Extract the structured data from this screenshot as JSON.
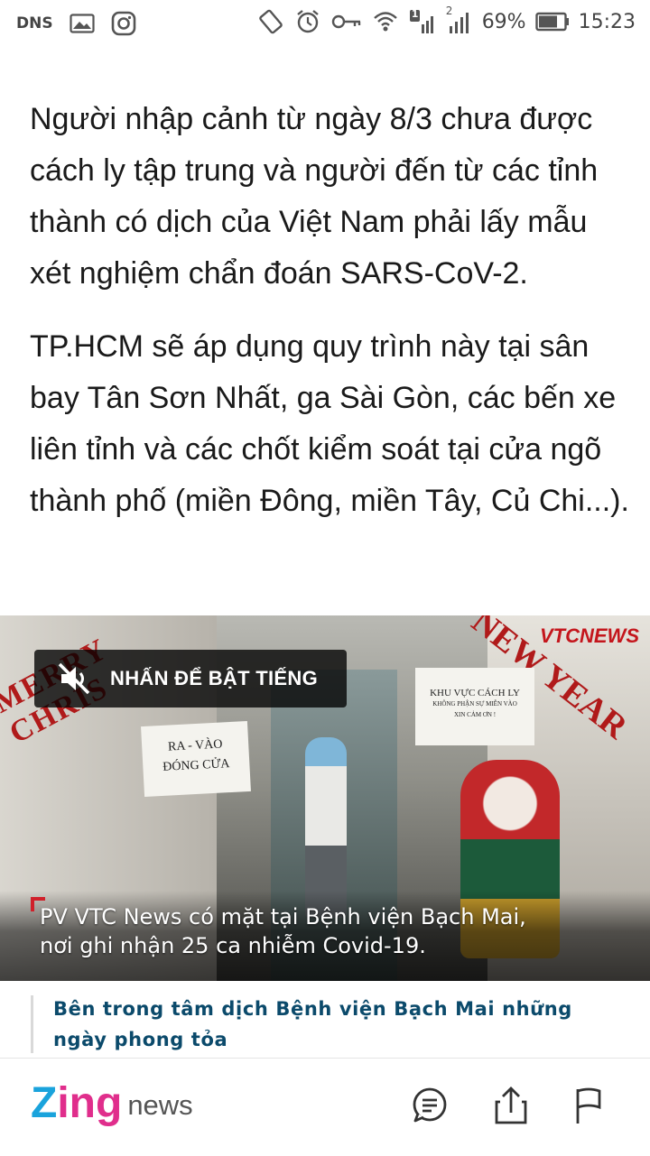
{
  "status_bar": {
    "carrier": "DNS",
    "sim1_badge": "1",
    "sim2_badge": "2",
    "battery": "69%",
    "time": "15:23",
    "icons": [
      "image-icon",
      "instagram-icon",
      "rotate-icon",
      "alarm-icon",
      "key-icon",
      "wifi-icon",
      "signal-icon",
      "battery-icon"
    ]
  },
  "article": {
    "paragraphs": [
      "Người nhập cảnh từ ngày 8/3 chưa được cách ly tập trung và người đến từ các tỉnh thành có dịch của Việt Nam phải lấy mẫu xét nghiệm chẩn đoán SARS-CoV-2.",
      "TP.HCM sẽ áp dụng quy trình này tại sân bay Tân Sơn Nhất, ga Sài Gòn, các bến xe liên tỉnh và các chốt kiểm soát tại cửa ngõ thành phố (miền Đông, miền Tây, Củ Chi...)."
    ]
  },
  "video": {
    "mute_label": "NHẤN ĐỂ BẬT TIẾNG",
    "caption_line1": "PV VTC News có mặt tại Bệnh viện Bạch Mai,",
    "caption_line2": "nơi ghi nhận 25 ca nhiễm Covid-19.",
    "logo": "VTCNEWS",
    "banner_left": "MERRY CHRIS",
    "banner_right": "NEW YEAR",
    "sign_left_line1": "RA - VÀO",
    "sign_left_line2": "ĐÓNG CỬA",
    "sign_right_line1": "KHU VỰC CÁCH LY",
    "sign_right_line2": "KHÔNG PHẬN SỰ MIỄN VÀO",
    "sign_right_line3": "XIN CẢM ƠN !"
  },
  "related": {
    "title": "Bên trong tâm dịch Bệnh viện Bạch Mai những ngày phong tỏa"
  },
  "toolbar": {
    "brand_z": "Z",
    "brand_ing": "ing",
    "brand_news": "news",
    "accent_blue": "#1aa3dc",
    "accent_pink": "#e02e8c",
    "link_color": "#0b4a6b"
  }
}
